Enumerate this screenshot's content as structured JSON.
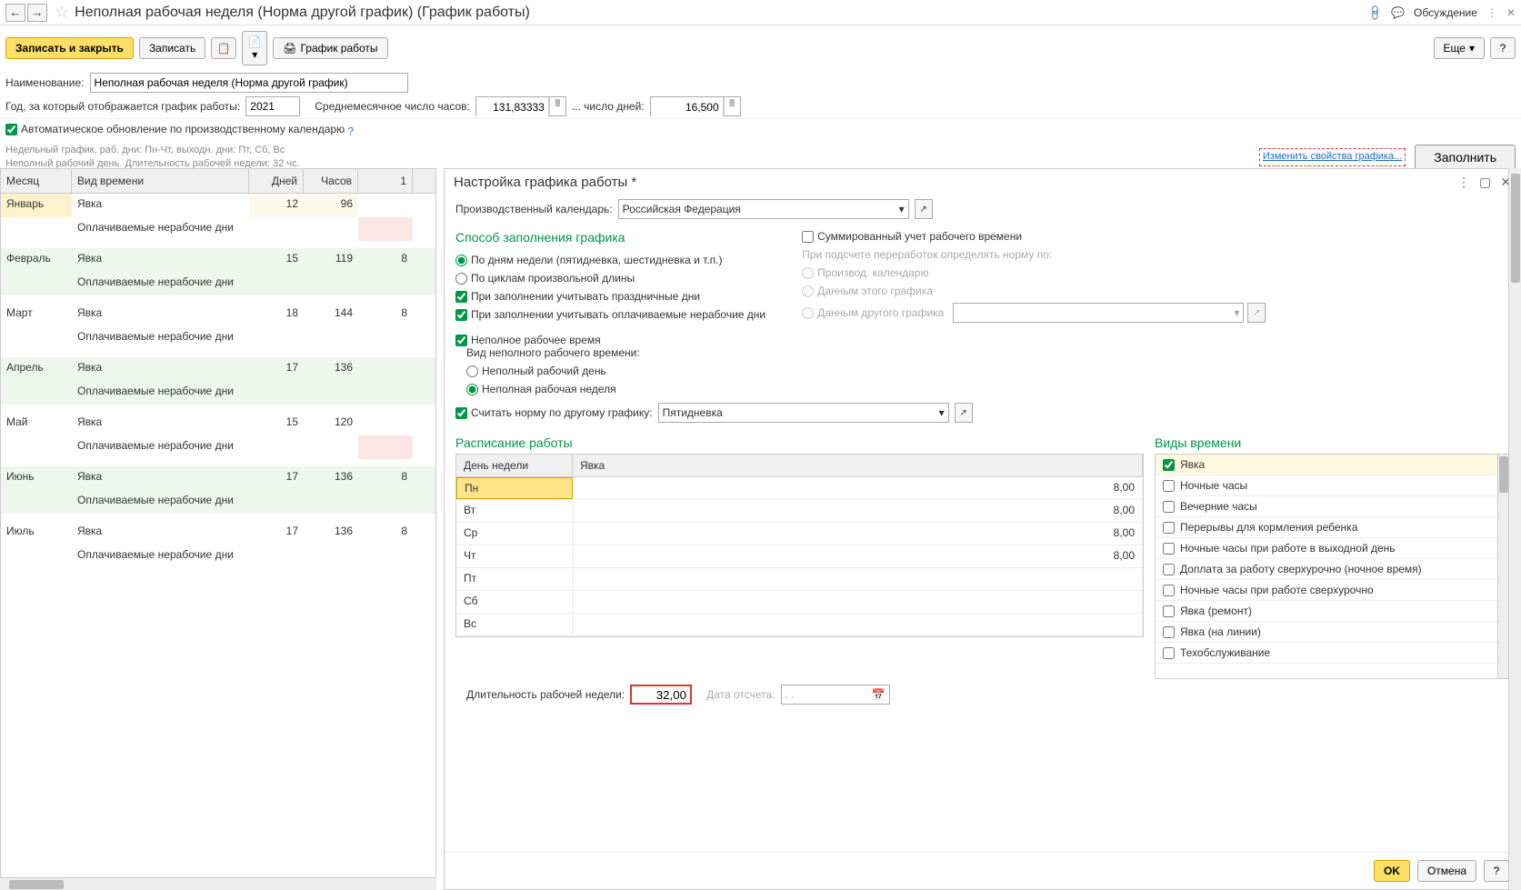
{
  "titlebar": {
    "title": "Неполная рабочая неделя (Норма другой график) (График работы)",
    "discussion": "Обсуждение"
  },
  "toolbar": {
    "save_close": "Записать и закрыть",
    "save": "Записать",
    "print": "График работы",
    "more": "Еще"
  },
  "fields": {
    "name_label": "Наименование:",
    "name_value": "Неполная рабочая неделя (Норма другой график)",
    "year_label": "Год, за который отображается график работы:",
    "year_value": "2021",
    "avg_hours_label": "Среднемесячное число часов:",
    "avg_hours_value": "131,83333",
    "avg_days_label": "... число дней:",
    "avg_days_value": "16,500",
    "auto_update": "Автоматическое обновление по производственному календарю",
    "desc1": "Недельный график, раб. дни: Пн-Чт, выходн. дни: Пт, Сб, Вс",
    "desc2": "Неполный рабочий день. Длительность рабочей недели: 32 чс.",
    "change_link": "Изменить свойства графика...",
    "fill_btn": "Заполнить"
  },
  "table": {
    "headers": {
      "month": "Месяц",
      "type": "Вид времени",
      "days": "Дней",
      "hours": "Часов",
      "col1": "1"
    },
    "rows": [
      {
        "month": "Январь",
        "type": "Явка",
        "days": "12",
        "hours": "96",
        "c1": "",
        "bg_month": "bg-yellow",
        "bg_days_hours": "bg-cream",
        "bg_c1": ""
      },
      {
        "month": "",
        "type": "Оплачиваемые нерабочие дни",
        "days": "",
        "hours": "",
        "c1": "",
        "bg_c1": "bg-pink"
      },
      {
        "month": "Февраль",
        "type": "Явка",
        "days": "15",
        "hours": "119",
        "c1": "8",
        "bg_row": "bg-green"
      },
      {
        "month": "",
        "type": "Оплачиваемые нерабочие дни",
        "days": "",
        "hours": "",
        "c1": "",
        "bg_row": "bg-green"
      },
      {
        "month": "Март",
        "type": "Явка",
        "days": "18",
        "hours": "144",
        "c1": "8"
      },
      {
        "month": "",
        "type": "Оплачиваемые нерабочие дни",
        "days": "",
        "hours": "",
        "c1": ""
      },
      {
        "month": "Апрель",
        "type": "Явка",
        "days": "17",
        "hours": "136",
        "c1": "",
        "bg_row": "bg-green"
      },
      {
        "month": "",
        "type": "Оплачиваемые нерабочие дни",
        "days": "",
        "hours": "",
        "c1": "",
        "bg_row": "bg-green"
      },
      {
        "month": "Май",
        "type": "Явка",
        "days": "15",
        "hours": "120",
        "c1": ""
      },
      {
        "month": "",
        "type": "Оплачиваемые нерабочие дни",
        "days": "",
        "hours": "",
        "c1": "",
        "bg_c1": "bg-pink"
      },
      {
        "month": "Июнь",
        "type": "Явка",
        "days": "17",
        "hours": "136",
        "c1": "8",
        "bg_row": "bg-green"
      },
      {
        "month": "",
        "type": "Оплачиваемые нерабочие дни",
        "days": "",
        "hours": "",
        "c1": "",
        "bg_row": "bg-green"
      },
      {
        "month": "Июль",
        "type": "Явка",
        "days": "17",
        "hours": "136",
        "c1": "8"
      },
      {
        "month": "",
        "type": "Оплачиваемые нерабочие дни",
        "days": "",
        "hours": "",
        "c1": ""
      }
    ]
  },
  "panel": {
    "title": "Настройка графика работы *",
    "calendar_label": "Производственный календарь:",
    "calendar_value": "Российская Федерация",
    "fill_section": "Способ заполнения графика",
    "fill_by_days": "По дням недели (пятидневка, шестидневка и т.п.)",
    "fill_by_cycles": "По циклам произвольной длины",
    "consider_holidays": "При заполнении учитывать праздничные дни",
    "consider_paid_off": "При заполнении учитывать оплачиваемые нерабочие дни",
    "sum_time": "Суммированный учет рабочего времени",
    "overtime_label": "При подсчете переработок определять норму по:",
    "overtime_r1": "Производ. календарю",
    "overtime_r2": "Данным этого графика",
    "overtime_r3": "Данным другого графика",
    "partial": "Неполное рабочее время",
    "partial_kind_label": "Вид неполного рабочего времени:",
    "partial_day": "Неполный рабочий день",
    "partial_week": "Неполная рабочая неделя",
    "calc_norm": "Считать норму по другому графику:",
    "calc_norm_value": "Пятидневка",
    "schedule_title": "Расписание работы",
    "types_title": "Виды времени",
    "day_header": "День недели",
    "att_header": "Явка",
    "days": [
      {
        "name": "Пн",
        "val": "8,00",
        "sel": true
      },
      {
        "name": "Вт",
        "val": "8,00"
      },
      {
        "name": "Ср",
        "val": "8,00"
      },
      {
        "name": "Чт",
        "val": "8,00"
      },
      {
        "name": "Пт",
        "val": ""
      },
      {
        "name": "Сб",
        "val": ""
      },
      {
        "name": "Вс",
        "val": ""
      }
    ],
    "types": [
      {
        "name": "Явка",
        "checked": true,
        "sel": true
      },
      {
        "name": "Ночные часы"
      },
      {
        "name": "Вечерние часы"
      },
      {
        "name": "Перерывы для кормления ребенка"
      },
      {
        "name": "Ночные часы при работе в выходной день"
      },
      {
        "name": "Доплата за работу сверхурочно (ночное время)"
      },
      {
        "name": "Ночные часы при работе сверхурочно"
      },
      {
        "name": "Явка (ремонт)"
      },
      {
        "name": "Явка (на линии)"
      },
      {
        "name": "Техобслуживание"
      }
    ],
    "duration_label": "Длительность рабочей недели:",
    "duration_value": "32,00",
    "start_date_label": "Дата отсчета:",
    "start_date_placeholder": ". .",
    "ok": "OK",
    "cancel": "Отмена"
  }
}
